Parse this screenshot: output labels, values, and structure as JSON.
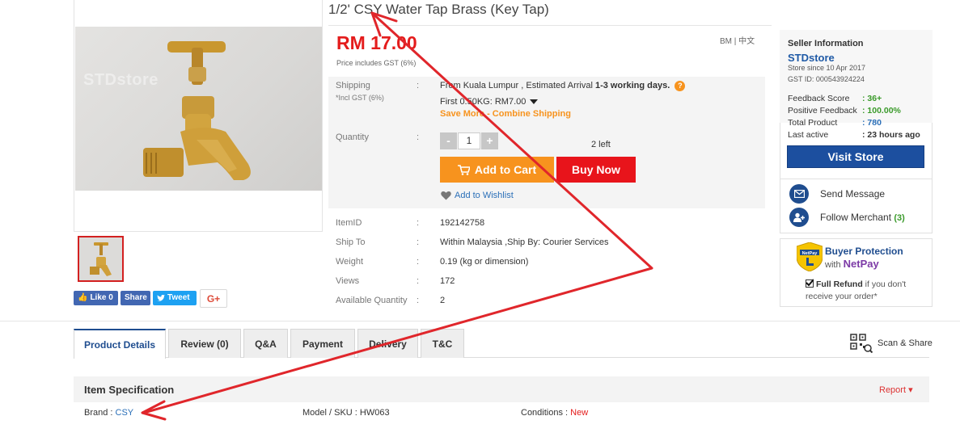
{
  "product": {
    "title": "1/2' CSY Water Tap Brass (Key Tap)",
    "watermark": "STDstore",
    "price": "RM 17.00",
    "price_note": "Price includes GST (6%)",
    "language_switch": "BM | 中文"
  },
  "social": {
    "like": "Like 0",
    "share": "Share",
    "tweet": "Tweet",
    "gplus": "G+"
  },
  "shipping": {
    "label": "Shipping",
    "sublabel": "*Incl GST (6%)",
    "colon": ":",
    "from_text": "From Kuala Lumpur , Estimated Arrival ",
    "arrival": "1-3 working days.",
    "first_rate": "First 0.50KG: RM7.00",
    "save_more": "Save More - Combine Shipping"
  },
  "quantity": {
    "label": "Quantity",
    "minus": "-",
    "value": "1",
    "plus": "+",
    "stock": "2 left"
  },
  "actions": {
    "add_to_cart": "Add to Cart",
    "buy_now": "Buy Now",
    "wishlist": "Add to Wishlist"
  },
  "specs": [
    {
      "label": "ItemID",
      "value": "192142758"
    },
    {
      "label": "Ship To",
      "value": "Within Malaysia ,Ship By: Courier Services"
    },
    {
      "label": "Weight",
      "value": "0.19 (kg or dimension)"
    },
    {
      "label": "Views",
      "value": "172"
    },
    {
      "label": "Available Quantity",
      "value": "2"
    }
  ],
  "seller": {
    "title": "Seller Information",
    "name": "STDstore",
    "since": "Store since 10 Apr 2017",
    "gst": "GST ID: 000543924224",
    "stats": [
      {
        "label": "Feedback Score",
        "value": ": 36+",
        "color": "#3a9a2a"
      },
      {
        "label": "Positive Feedback",
        "value": ": 100.00%",
        "color": "#3a9a2a"
      },
      {
        "label": "Total Product",
        "value": ": 780",
        "color": "#2a6fb8"
      },
      {
        "label": "Last active",
        "value": ": 23 hours ago",
        "color": "#333333"
      }
    ],
    "visit": "Visit Store",
    "send_message": "Send Message",
    "follow": "Follow Merchant",
    "follow_count": "(3)"
  },
  "protection": {
    "title": "Buyer Protection",
    "with": "with",
    "netpay": "NetPay",
    "badge": "NetPay",
    "refund_bold": "Full Refund",
    "refund_rest": " if you don't receive your order*"
  },
  "tabs": [
    "Product Details",
    "Review (0)",
    "Q&A",
    "Payment",
    "Delivery",
    "T&C"
  ],
  "scan_share": "Scan & Share",
  "item_spec": {
    "title": "Item Specification",
    "report": "Report ▾",
    "brand_label": "Brand : ",
    "brand_value": "CSY",
    "model_label": "Model / SKU : HW063",
    "condition_label": "Conditions : ",
    "condition_value": "New"
  },
  "colors": {
    "price_red": "#e41c1c",
    "cart_orange": "#f7931e",
    "buy_red": "#e8141b",
    "store_blue": "#1c4f9f",
    "annotation_red": "#e0262b"
  }
}
